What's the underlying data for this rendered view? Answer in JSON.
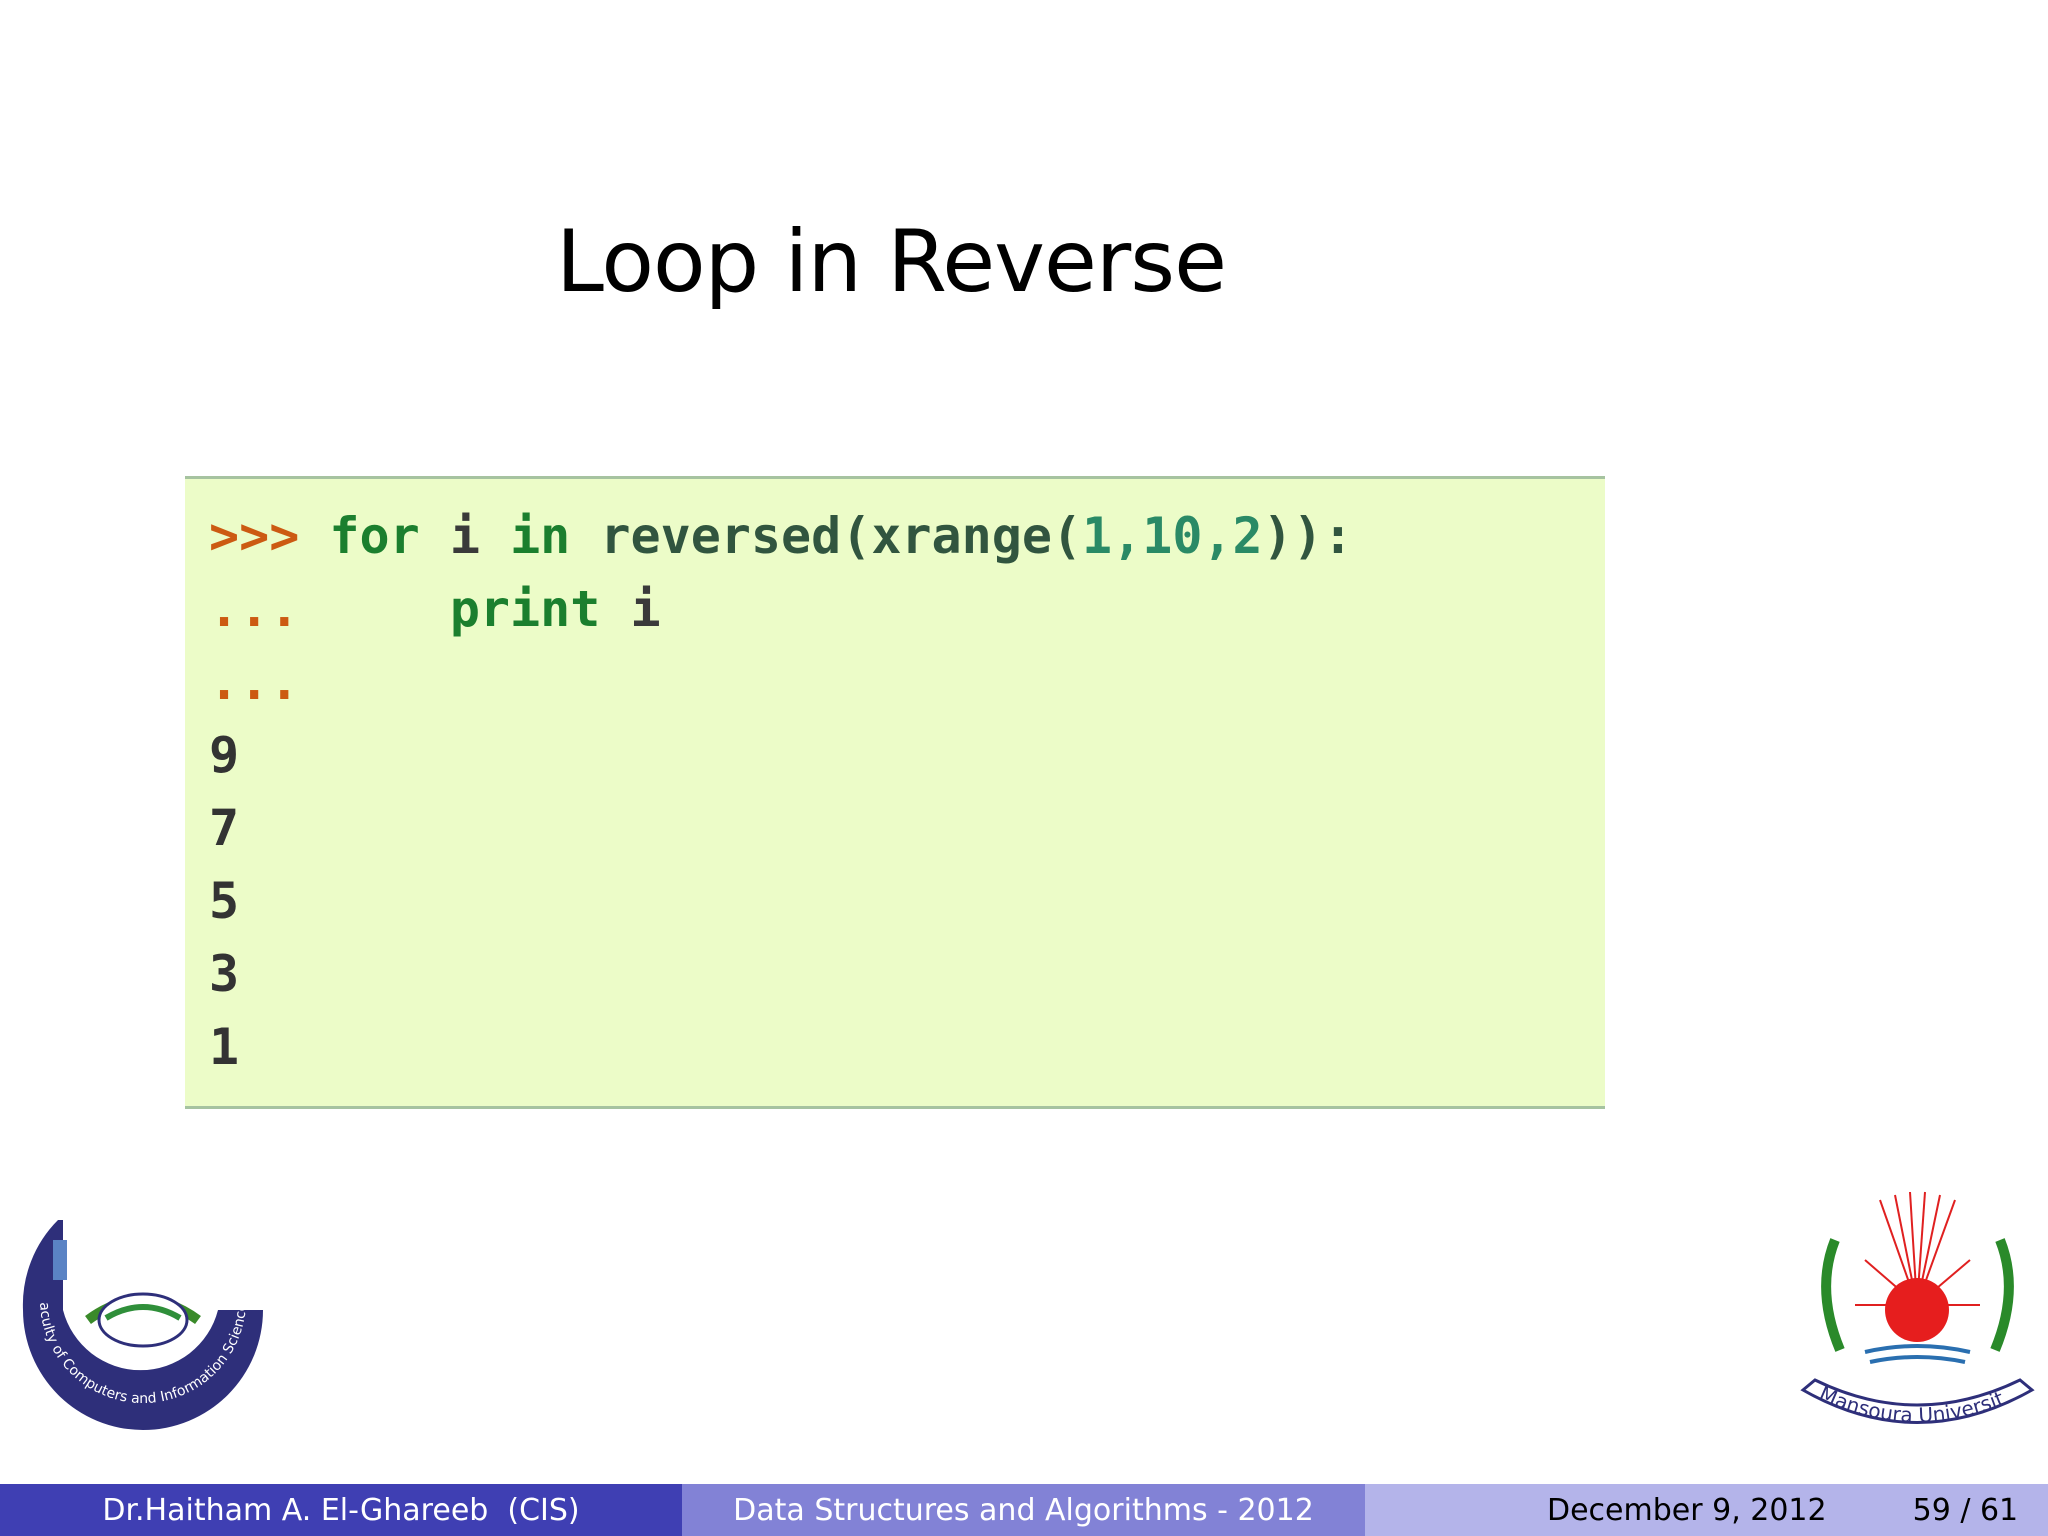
{
  "slide": {
    "title": "Loop in Reverse"
  },
  "code": {
    "prompt_main": ">>>",
    "prompt_cont": "...",
    "kw_for": "for",
    "var_i": "i",
    "kw_in": "in",
    "fn_reversed": "reversed(xrange(",
    "args": "1,10,2",
    "close": ")):",
    "kw_print": "print",
    "print_arg": "i",
    "outputs": [
      "9",
      "7",
      "5",
      "3",
      "1"
    ]
  },
  "logos": {
    "left_text": "Faculty of Computers and Information Sciences",
    "right_text": "Mansoura University"
  },
  "footer": {
    "author": "Dr.Haitham A. El-Ghareeb  (CIS)",
    "course": "Data Structures and Algorithms - 2012",
    "date": "December 9, 2012",
    "pages": "59 / 61"
  },
  "colors": {
    "code_bg": "#ecfcc8",
    "prompt": "#cc5a12",
    "keyword": "#1b7f2e",
    "footer_dark": "#3f3fb3",
    "footer_mid": "#8282d6",
    "footer_light": "#b4b4ea"
  }
}
